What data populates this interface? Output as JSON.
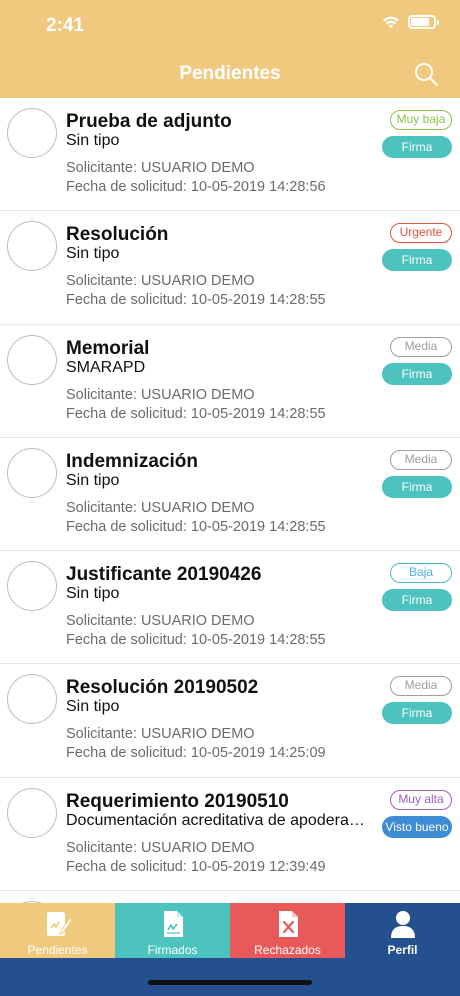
{
  "status_bar": {
    "time": "2:41"
  },
  "header": {
    "title": "Pendientes"
  },
  "items": [
    {
      "title": "Prueba de adjunto",
      "subtitle": "Sin tipo",
      "requester": "Solicitante: USUARIO DEMO",
      "date": "Fecha de solicitud: 10-05-2019 14:28:56",
      "priority": "Muy baja",
      "priority_color": "#8bc34a",
      "action": "Firma",
      "action_color": "#4cc3bf"
    },
    {
      "title": "Resolución",
      "subtitle": "Sin tipo",
      "requester": "Solicitante: USUARIO DEMO",
      "date": "Fecha de solicitud: 10-05-2019 14:28:55",
      "priority": "Urgente",
      "priority_color": "#e0533d",
      "action": "Firma",
      "action_color": "#4cc3bf"
    },
    {
      "title": "Memorial",
      "subtitle": "SMARAPD",
      "requester": "Solicitante: USUARIO DEMO",
      "date": "Fecha de solicitud: 10-05-2019 14:28:55",
      "priority": "Media",
      "priority_color": "#9e9e9e",
      "action": "Firma",
      "action_color": "#4cc3bf"
    },
    {
      "title": "Indemnización",
      "subtitle": "Sin tipo",
      "requester": "Solicitante: USUARIO DEMO",
      "date": "Fecha de solicitud: 10-05-2019 14:28:55",
      "priority": "Media",
      "priority_color": "#9e9e9e",
      "action": "Firma",
      "action_color": "#4cc3bf"
    },
    {
      "title": "Justificante 20190426",
      "subtitle": "Sin tipo",
      "requester": "Solicitante: USUARIO DEMO",
      "date": "Fecha de solicitud: 10-05-2019 14:28:55",
      "priority": "Baja",
      "priority_color": "#4fb3d9",
      "action": "Firma",
      "action_color": "#4cc3bf"
    },
    {
      "title": "Resolución 20190502",
      "subtitle": "Sin tipo",
      "requester": "Solicitante: USUARIO DEMO",
      "date": "Fecha de solicitud: 10-05-2019 14:25:09",
      "priority": "Media",
      "priority_color": "#9e9e9e",
      "action": "Firma",
      "action_color": "#4cc3bf"
    },
    {
      "title": "Requerimiento 20190510",
      "subtitle": "Documentación acreditativa de apoderamiento",
      "requester": "Solicitante: USUARIO DEMO",
      "date": "Fecha de solicitud: 10-05-2019 12:39:49",
      "priority": "Muy alta",
      "priority_color": "#a05cc0",
      "action": "Visto bueno",
      "action_color": "#3f8bd6"
    }
  ],
  "tabs": [
    {
      "label": "Pendientes",
      "icon": "sign-document-icon",
      "bg": "#f0c97f"
    },
    {
      "label": "Firmados",
      "icon": "signed-document-icon",
      "bg": "#4cc3bf"
    },
    {
      "label": "Rechazados",
      "icon": "rejected-document-icon",
      "bg": "#e85a5a"
    },
    {
      "label": "Perfil",
      "icon": "user-icon",
      "bg": "#24508f"
    }
  ]
}
